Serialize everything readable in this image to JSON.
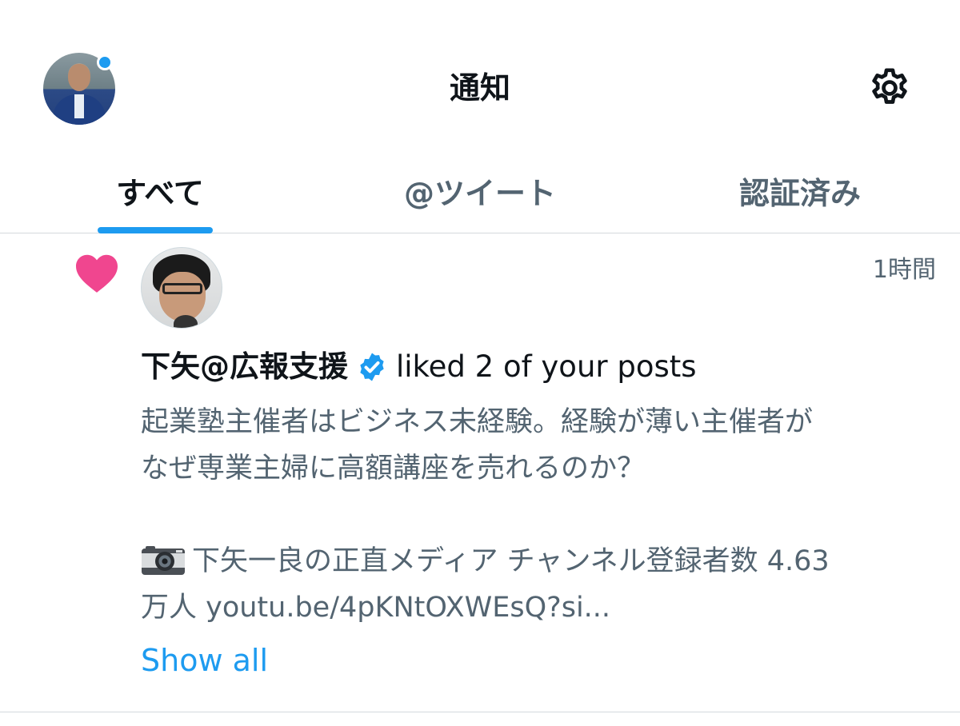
{
  "header": {
    "title": "通知",
    "accent_color": "#1d9bf0"
  },
  "tabs": [
    {
      "label": "すべて",
      "active": true
    },
    {
      "label": "@ツイート",
      "active": false
    },
    {
      "label": "認証済み",
      "active": false
    }
  ],
  "notification": {
    "type_icon": "heart-icon",
    "type_icon_color": "#f91880",
    "timestamp": "1時間",
    "user_name": "下矢@広報支援",
    "verified": true,
    "action": "liked 2 of your posts",
    "post_lines": [
      "起業塾主催者はビジネス未経験。経験が薄い主催者が",
      "なぜ専業主婦に高額講座を売れるのか？",
      "",
      "下矢一良の正直メディア チャンネル登録者数 4.63",
      "万人 youtu.be/4pKNtOXWEsQ?si..."
    ],
    "show_all_label": "Show all"
  }
}
